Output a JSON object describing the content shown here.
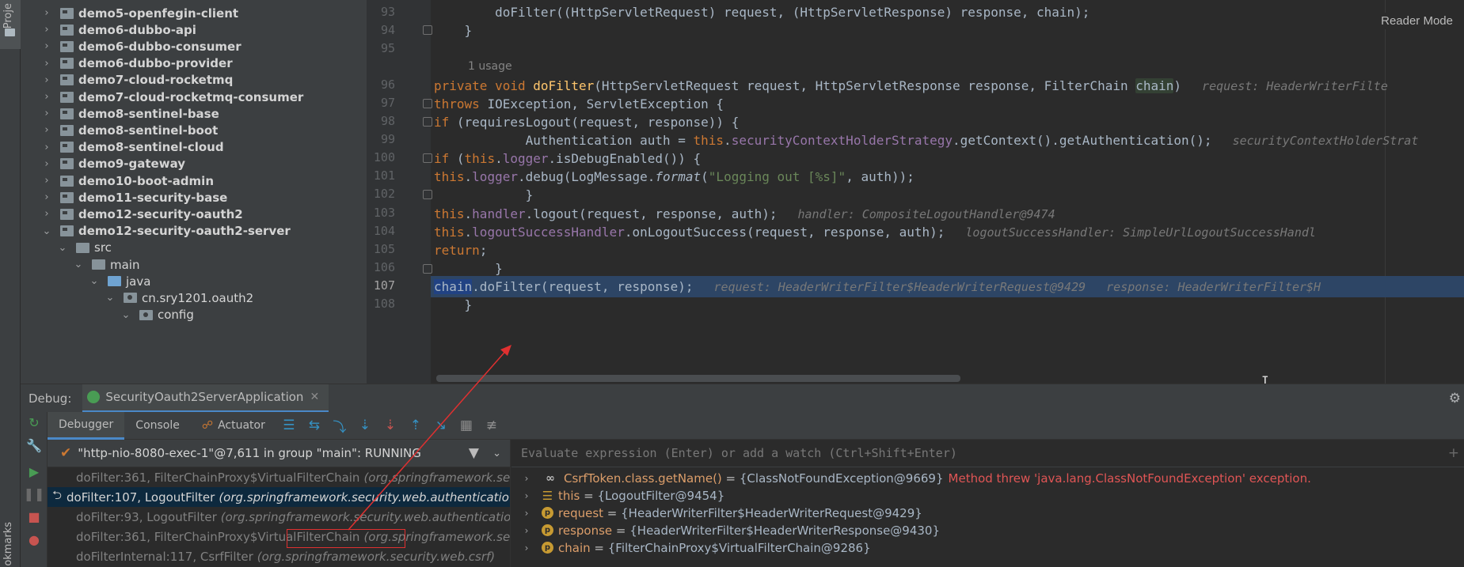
{
  "side_strip": {
    "project_label": "Proje",
    "bookmarks_label": "okmarks"
  },
  "project_tree": {
    "items": [
      {
        "label": "demo5-openfegin-client",
        "type": "module",
        "expanded": false
      },
      {
        "label": "demo6-dubbo-api",
        "type": "module",
        "expanded": false
      },
      {
        "label": "demo6-dubbo-consumer",
        "type": "module",
        "expanded": false
      },
      {
        "label": "demo6-dubbo-provider",
        "type": "module",
        "expanded": false
      },
      {
        "label": "demo7-cloud-rocketmq",
        "type": "module",
        "expanded": false
      },
      {
        "label": "demo7-cloud-rocketmq-consumer",
        "type": "module",
        "expanded": false
      },
      {
        "label": "demo8-sentinel-base",
        "type": "module",
        "expanded": false
      },
      {
        "label": "demo8-sentinel-boot",
        "type": "module",
        "expanded": false
      },
      {
        "label": "demo8-sentinel-cloud",
        "type": "module",
        "expanded": false
      },
      {
        "label": "demo9-gateway",
        "type": "module",
        "expanded": false
      },
      {
        "label": "demo10-boot-admin",
        "type": "module",
        "expanded": false
      },
      {
        "label": "demo11-security-base",
        "type": "module",
        "expanded": false
      },
      {
        "label": "demo12-security-oauth2",
        "type": "module",
        "expanded": false
      },
      {
        "label": "demo12-security-oauth2-server",
        "type": "module",
        "expanded": true
      },
      {
        "label": "src",
        "type": "folder",
        "expanded": true
      },
      {
        "label": "main",
        "type": "folder",
        "expanded": true
      },
      {
        "label": "java",
        "type": "folder-blue",
        "expanded": true
      },
      {
        "label": "cn.sry1201.oauth2",
        "type": "package",
        "expanded": true
      },
      {
        "label": "config",
        "type": "package",
        "expanded": true
      }
    ]
  },
  "editor": {
    "reader_mode_label": "Reader Mode",
    "usage_hint": "1 usage",
    "line_numbers": [
      "93",
      "94",
      "95",
      "96",
      "97",
      "98",
      "99",
      "100",
      "101",
      "102",
      "103",
      "104",
      "105",
      "106",
      "107",
      "108"
    ],
    "current_line": "107",
    "inlay": {
      "l96": "request: HeaderWriterFilte",
      "l99": "securityContextHolderStrat",
      "l103": "handler: CompositeLogoutHandler@9474",
      "l104": "logoutSuccessHandler: SimpleUrlLogoutSuccessHandl",
      "l107a": "request: HeaderWriterFilter$HeaderWriterRequest@9429",
      "l107b": "response: HeaderWriterFilter$H"
    }
  },
  "debug": {
    "title": "Debug:",
    "session_name": "SecurityOauth2ServerApplication",
    "tabs": [
      "Debugger",
      "Console",
      "Actuator"
    ],
    "thread": "\"http-nio-8080-exec-1\"@7,611 in group \"main\": RUNNING",
    "frames": [
      {
        "method": "doFilter:361, FilterChainProxy$VirtualFilterChain",
        "cls": "(org.springframework.security.we",
        "selected": false
      },
      {
        "method": "doFilter:107, LogoutFilter",
        "cls": "(org.springframework.security.web.authenticatio",
        "selected": true
      },
      {
        "method": "doFilter:93, LogoutFilter",
        "cls": "(org.springframework.security.web.authentication.",
        "selected": false
      },
      {
        "method": "doFilter:361, FilterChainProxy$VirtualFilterChain",
        "cls": "(org.springframework.security.we",
        "selected": false
      },
      {
        "method": "doFilterInternal:117, CsrfFilter",
        "cls": "(org.springframework.security.web.csrf)",
        "selected": false
      }
    ],
    "evaluate_placeholder": "Evaluate expression (Enter) or add a watch (Ctrl+Shift+Enter)",
    "variables": [
      {
        "icon": "watch",
        "name": "CsrfToken.class.getName()",
        "value": "{ClassNotFoundException@9669}",
        "error": "Method threw 'java.lang.ClassNotFoundException' exception."
      },
      {
        "icon": "list",
        "name": "this",
        "value": "{LogoutFilter@9454}",
        "error": ""
      },
      {
        "icon": "p",
        "name": "request",
        "value": "{HeaderWriterFilter$HeaderWriterRequest@9429}",
        "error": ""
      },
      {
        "icon": "p",
        "name": "response",
        "value": "{HeaderWriterFilter$HeaderWriterResponse@9430}",
        "error": ""
      },
      {
        "icon": "p",
        "name": "chain",
        "value": "{FilterChainProxy$VirtualFilterChain@9286}",
        "error": ""
      }
    ]
  },
  "colors": {
    "accent": "#4a88c7",
    "annotation_red": "#e03030",
    "exec_line": "#2d4565"
  }
}
